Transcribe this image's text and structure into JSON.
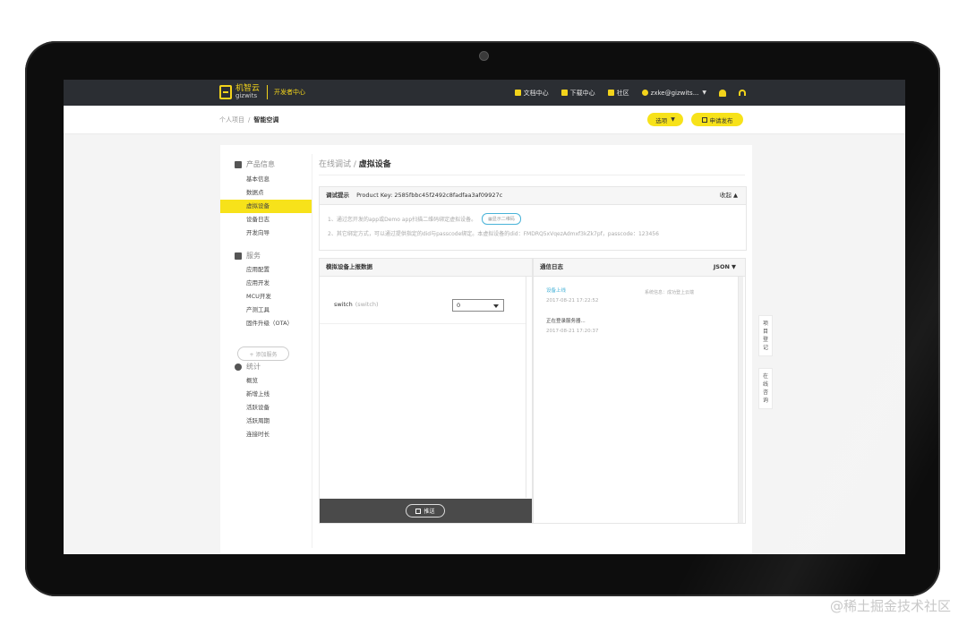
{
  "topbar": {
    "logo_cn": "机智云",
    "logo_en": "gizwits",
    "dev_center": "开发者中心",
    "nav": {
      "docs": "文档中心",
      "download": "下载中心",
      "community": "社区",
      "user": "zxke@gizwits..."
    }
  },
  "subbar": {
    "crumb_parent": "个人项目",
    "crumb_current": "智能空调",
    "options_label": "选项",
    "publish_label": "申请发布"
  },
  "sidebar": {
    "groups": [
      {
        "label": "产品信息",
        "items": [
          "基本信息",
          "数据点",
          "虚拟设备",
          "设备日志",
          "开发向导"
        ]
      },
      {
        "label": "服务",
        "items": [
          "应用配置",
          "应用开发",
          "MCU开发",
          "产测工具",
          "固件升级（OTA）"
        ]
      },
      {
        "label": "统计",
        "items": [
          "概览",
          "新增上线",
          "活跃设备",
          "活跃周期",
          "连接时长"
        ]
      }
    ],
    "active_item": "虚拟设备",
    "add_service": "+ 添加服务"
  },
  "main": {
    "title_prefix": "在线调试 / ",
    "title_current": "虚拟设备",
    "tips": {
      "label": "调试提示",
      "product_key": "Product Key: 2585fbbc45f2492c8fadfaa3af09927c",
      "fold": "收起",
      "line1": "1、通过您开发的app或Demo app扫描二维码绑定虚拟设备。",
      "qr_button": "显示二维码",
      "line2": "2、其它绑定方式，可以通过提供指定的did与passcode绑定。本虚拟设备的did：FMDRQ5xVqezAdmxf3kZk7pf，passcode：123456"
    },
    "simulate": {
      "title": "模拟设备上报数据",
      "field_name": "switch",
      "field_hint": "(switch)",
      "field_value": "0",
      "push_label": "推送"
    },
    "log": {
      "title": "通信日志",
      "format": "JSON",
      "entries": [
        {
          "event": "设备上线",
          "time": "2017-08-21 17:22:52",
          "note": "系统信息：成功登上云端"
        },
        {
          "event": "正在登录服务器...",
          "time": "2017-08-21 17:20:37",
          "note": ""
        }
      ]
    }
  },
  "float_tabs": {
    "register": "项目登记",
    "consult": "在线咨询"
  },
  "watermark": "@稀土掘金技术社区"
}
